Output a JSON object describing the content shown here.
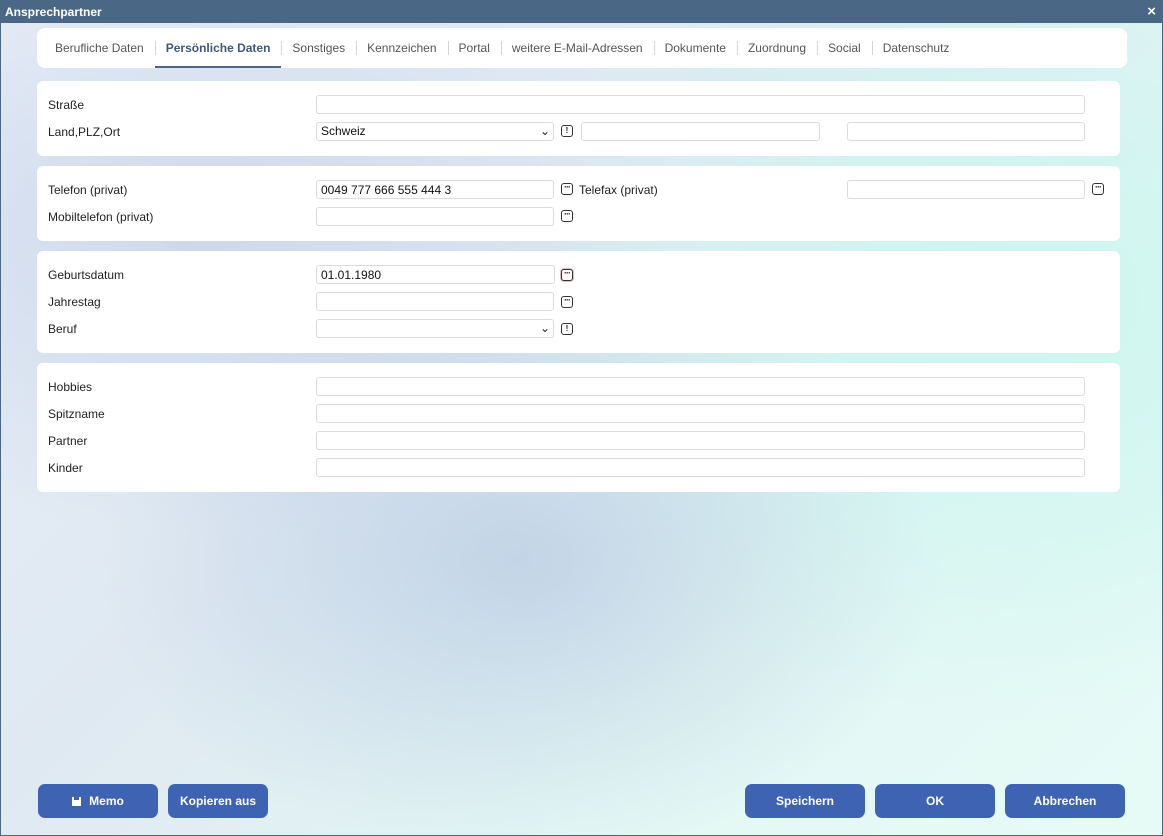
{
  "window": {
    "title": "Ansprechpartner",
    "close": "×"
  },
  "tabs": [
    {
      "label": "Berufliche Daten",
      "active": false
    },
    {
      "label": "Persönliche Daten",
      "active": true
    },
    {
      "label": "Sonstiges",
      "active": false
    },
    {
      "label": "Kennzeichen",
      "active": false
    },
    {
      "label": "Portal",
      "active": false
    },
    {
      "label": "weitere E-Mail-Adressen",
      "active": false
    },
    {
      "label": "Dokumente",
      "active": false
    },
    {
      "label": "Zuordnung",
      "active": false
    },
    {
      "label": "Social",
      "active": false
    },
    {
      "label": "Datenschutz",
      "active": false
    }
  ],
  "address": {
    "strasse_label": "Straße",
    "strasse_value": "",
    "land_label": "Land,PLZ,Ort",
    "land_value": "Schweiz",
    "plz_value": "",
    "ort_value": ""
  },
  "phone": {
    "telefon_label": "Telefon (privat)",
    "telefon_value": "0049 777 666 555 444 3",
    "telefax_label": "Telefax (privat)",
    "telefax_value": "",
    "mobil_label": "Mobiltelefon (privat)",
    "mobil_value": ""
  },
  "dates": {
    "geburtsdatum_label": "Geburtsdatum",
    "geburtsdatum_value": "01.01.1980",
    "jahrestag_label": "Jahrestag",
    "jahrestag_value": "",
    "beruf_label": "Beruf",
    "beruf_value": ""
  },
  "misc": {
    "hobbies_label": "Hobbies",
    "hobbies_value": "",
    "spitzname_label": "Spitzname",
    "spitzname_value": "",
    "partner_label": "Partner",
    "partner_value": "",
    "kinder_label": "Kinder",
    "kinder_value": ""
  },
  "icons": {
    "info": "!",
    "more": "···",
    "chevron": "⌄"
  },
  "buttons": {
    "memo": "Memo",
    "kopieren": "Kopieren aus",
    "speichern": "Speichern",
    "ok": "OK",
    "abbrechen": "Abbrechen"
  },
  "colors": {
    "titlebar": "#4a6785",
    "button": "#3f63b3",
    "active_tab": "#3d5a78"
  }
}
